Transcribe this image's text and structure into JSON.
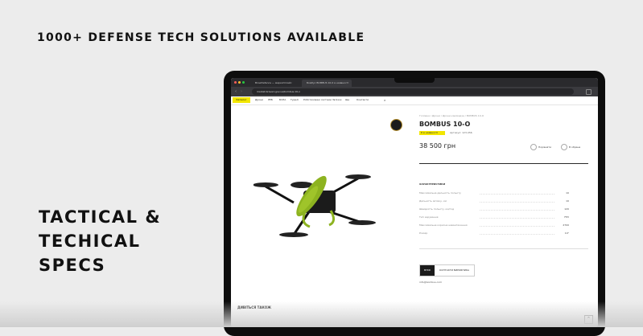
{
  "headline": "1000+ DEFENSE TECH SOLUTIONS AVAILABLE",
  "side_title": [
    "TACTICAL &",
    "TECHICAL",
    "SPECS"
  ],
  "browser": {
    "tabs": [
      "BrowDefence — маркетплейс",
      "Бомбус BOMBUS 10-0 в наявності"
    ],
    "url": "market.brave1.gov.ua/bombus-10-o"
  },
  "site_nav": {
    "catalog_label": "Каталог",
    "items": [
      "Дрони",
      "РЕБ",
      "БпЛА",
      "Турелі",
      "Роботизовані системи",
      "Зв'язок",
      "Ще",
      "Контакти"
    ]
  },
  "product": {
    "breadcrumbs": "Головна / Дрони / Дрони-камікадзе / BOMBUS 10-O",
    "title": "BOMBUS 10-O",
    "availability_badge": "Є в наявності",
    "article": "Артикул: 123-456",
    "price": "38 500 грн",
    "actions": [
      "Порівняти",
      "В обране"
    ],
    "specs_heading": "ХАРАКТЕРИСТИКИ",
    "specs": [
      {
        "label": "Максимальна дальність польоту",
        "value": "10"
      },
      {
        "label": "Дальність зв'язку, км",
        "value": "10"
      },
      {
        "label": "Швидкість польоту, км/год",
        "value": "120"
      },
      {
        "label": "Тип керування",
        "value": "FPV"
      },
      {
        "label": "Максимальне корисне навантаження",
        "value": "2700"
      },
      {
        "label": "Розмір",
        "value": "10\""
      }
    ],
    "manufacturer_logo": "BYRD",
    "manufacturer_button": "КОНТАКТИ ВИРОБНИКА",
    "email": "info@bombus.com"
  },
  "see_also": "ДИВІТЬСЯ ТАКОЖ",
  "scroll_top": "^",
  "colors": {
    "accent_yellow": "#f2e600",
    "drone_body": "#8db320"
  }
}
